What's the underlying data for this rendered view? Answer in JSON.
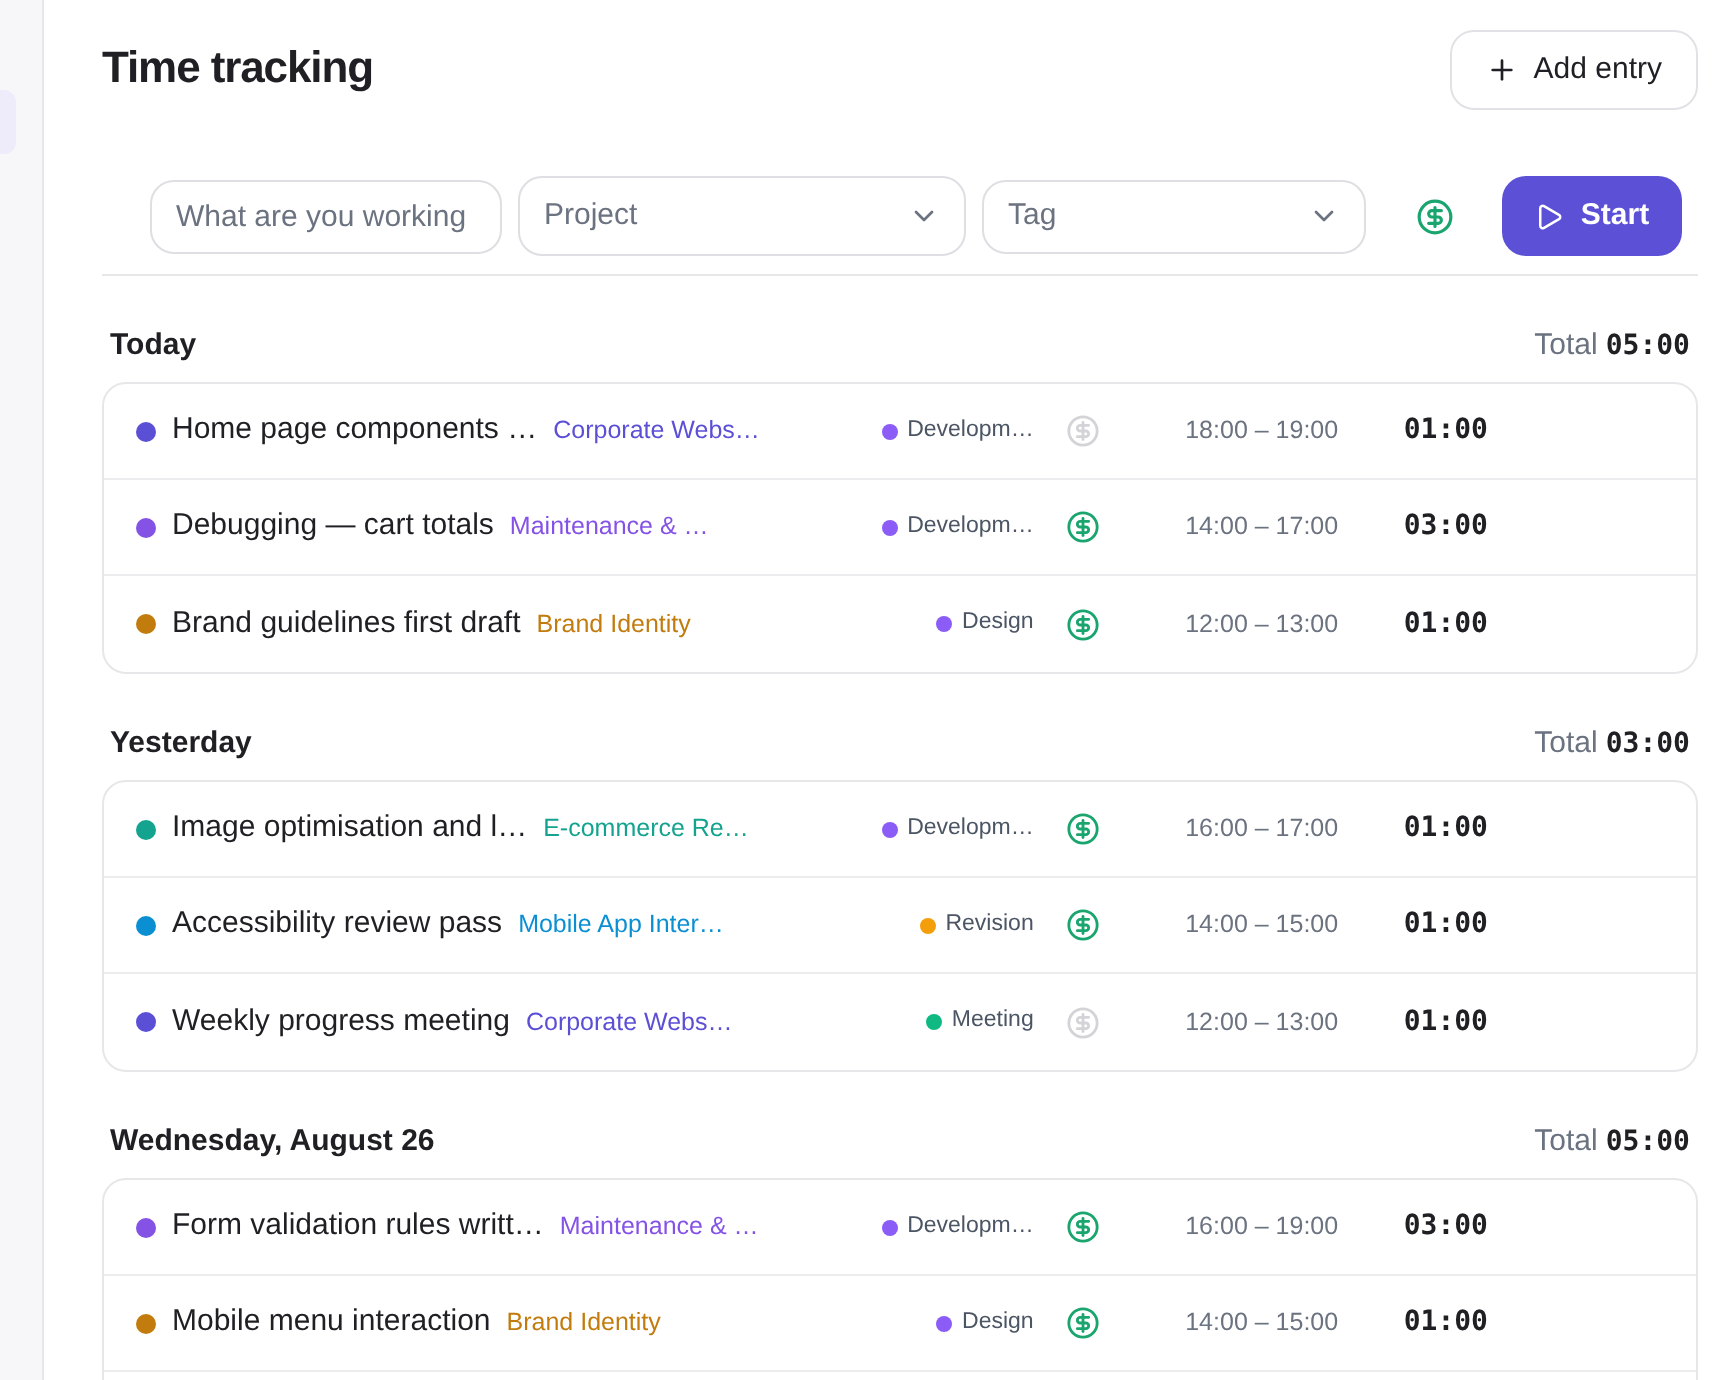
{
  "page": {
    "title": "Time tracking",
    "add_button": "Add entry"
  },
  "toolbar": {
    "description": {
      "placeholder": "What are you working"
    },
    "project": {
      "placeholder": "Project"
    },
    "tag": {
      "placeholder": "Tag"
    },
    "start_button": "Start"
  },
  "groups": [
    {
      "label": "Today",
      "total_label": "Total",
      "total": "05:00",
      "entries": [
        {
          "description": "Home page components …",
          "project": {
            "name": "Corporate Webs…",
            "color": "#5b4fd6"
          },
          "tag": {
            "name": "Developm…",
            "color": "#8b5cf6"
          },
          "billable": false,
          "time": "18:00 – 19:00",
          "duration": "01:00"
        },
        {
          "description": "Debugging — cart totals",
          "project": {
            "name": "Maintenance & …",
            "color": "#8552e6"
          },
          "tag": {
            "name": "Developm…",
            "color": "#8b5cf6"
          },
          "billable": true,
          "time": "14:00 – 17:00",
          "duration": "03:00"
        },
        {
          "description": "Brand guidelines first draft",
          "project": {
            "name": "Brand Identity",
            "color": "#c27c0e"
          },
          "tag": {
            "name": "Design",
            "color": "#8b5cf6"
          },
          "billable": true,
          "time": "12:00 – 13:00",
          "duration": "01:00"
        }
      ]
    },
    {
      "label": "Yesterday",
      "total_label": "Total",
      "total": "03:00",
      "entries": [
        {
          "description": "Image optimisation and l…",
          "project": {
            "name": "E-commerce Re…",
            "color": "#14a38f"
          },
          "tag": {
            "name": "Developm…",
            "color": "#8b5cf6"
          },
          "billable": true,
          "time": "16:00 – 17:00",
          "duration": "01:00"
        },
        {
          "description": "Accessibility review pass",
          "project": {
            "name": "Mobile App Inter…",
            "color": "#0b8fd3"
          },
          "tag": {
            "name": "Revision",
            "color": "#f59e0b"
          },
          "billable": true,
          "time": "14:00 – 15:00",
          "duration": "01:00"
        },
        {
          "description": "Weekly progress meeting",
          "project": {
            "name": "Corporate Webs…",
            "color": "#5b4fd6"
          },
          "tag": {
            "name": "Meeting",
            "color": "#10b981"
          },
          "billable": false,
          "time": "12:00 – 13:00",
          "duration": "01:00"
        }
      ]
    },
    {
      "label": "Wednesday, August 26",
      "total_label": "Total",
      "total": "05:00",
      "entries": [
        {
          "description": "Form validation rules writt…",
          "project": {
            "name": "Maintenance & …",
            "color": "#8552e6"
          },
          "tag": {
            "name": "Developm…",
            "color": "#8b5cf6"
          },
          "billable": true,
          "time": "16:00 – 19:00",
          "duration": "03:00"
        },
        {
          "description": "Mobile menu interaction",
          "project": {
            "name": "Brand Identity",
            "color": "#c27c0e"
          },
          "tag": {
            "name": "Design",
            "color": "#8b5cf6"
          },
          "billable": true,
          "time": "14:00 – 15:00",
          "duration": "01:00"
        }
      ]
    }
  ]
}
